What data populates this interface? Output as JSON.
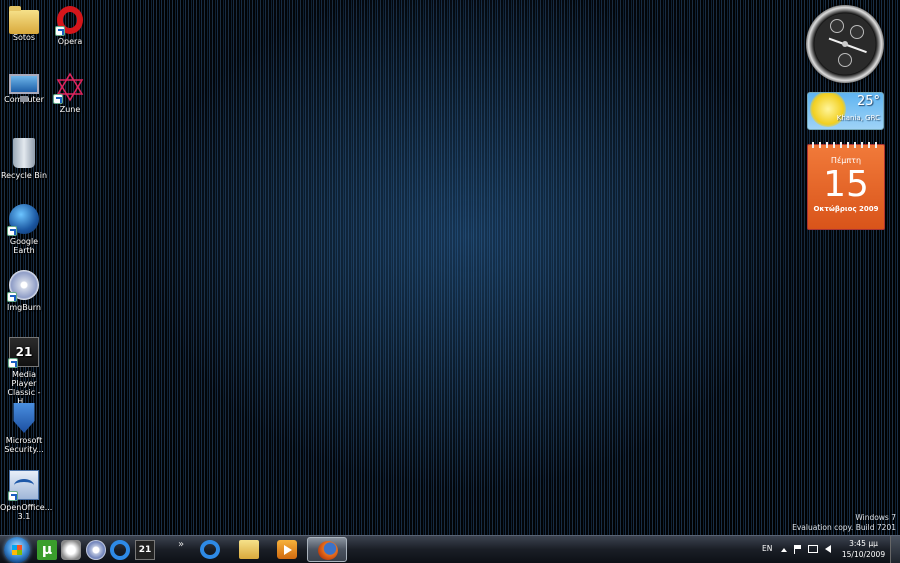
{
  "desktop": {
    "icons": [
      {
        "label": "Sotos",
        "icon": "folder-icon",
        "shortcut": false
      },
      {
        "label": "Opera",
        "icon": "opera-icon",
        "shortcut": true
      },
      {
        "label": "Computer",
        "icon": "computer-icon",
        "shortcut": false
      },
      {
        "label": "Zune",
        "icon": "zune-icon",
        "shortcut": true
      },
      {
        "label": "Recycle Bin",
        "icon": "recycle-bin-icon",
        "shortcut": false
      },
      {
        "label": "Google Earth",
        "icon": "google-earth-icon",
        "shortcut": true
      },
      {
        "label": "ImgBurn",
        "icon": "imgburn-icon",
        "shortcut": true
      },
      {
        "label": "Media Player Classic - H...",
        "icon": "media-player-classic-icon",
        "shortcut": true
      },
      {
        "label": "Microsoft Security...",
        "icon": "microsoft-security-icon",
        "shortcut": true
      },
      {
        "label": "OpenOffice... 3.1",
        "icon": "openoffice-icon",
        "shortcut": true
      }
    ],
    "watermark": {
      "line1": "Windows 7",
      "line2": "Evaluation copy. Build 7201"
    }
  },
  "gadgets": {
    "weather": {
      "temperature": "25°",
      "location": "Khania, GRC"
    },
    "calendar": {
      "weekday": "Πέμπτη",
      "day": "15",
      "month_year": "Οκτώβριος 2009"
    }
  },
  "taskbar": {
    "quick_launch": [
      "utorrent-icon",
      "ultra-icon",
      "imgburn-icon",
      "ie-icon",
      "media-player-classic-icon"
    ],
    "overflow": "»",
    "buttons": [
      {
        "icon": "internet-explorer-icon",
        "active": false
      },
      {
        "icon": "windows-explorer-icon",
        "active": false
      },
      {
        "icon": "windows-media-player-icon",
        "active": false
      },
      {
        "icon": "firefox-icon",
        "active": true
      }
    ],
    "language": "EN",
    "time": "3:45 μμ",
    "date": "15/10/2009"
  },
  "colors": {
    "calendar": "#e6622a",
    "taskbar": "#1a1e26",
    "start_orb": "#3f8fd8"
  }
}
